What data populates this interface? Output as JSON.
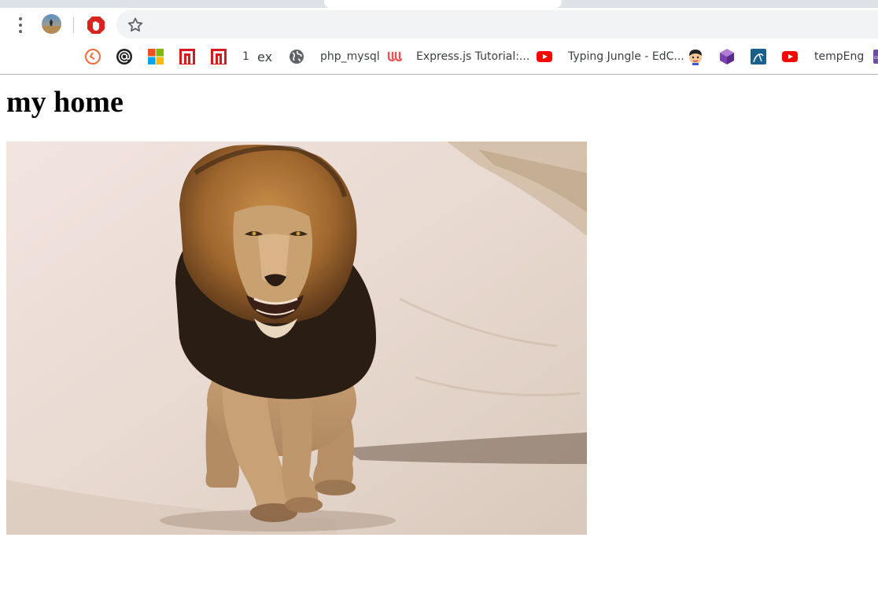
{
  "browser": {
    "bookmarks": [
      {
        "label": "",
        "icon": "clockify-icon"
      },
      {
        "label": "",
        "icon": "at-sign-icon"
      },
      {
        "label": "",
        "icon": "microsoft-icon"
      },
      {
        "label": "",
        "icon": "red-n-icon"
      },
      {
        "label": "",
        "icon": "red-n-icon"
      },
      {
        "label": "1",
        "icon": ""
      },
      {
        "label": "ex",
        "icon": ""
      },
      {
        "label": "php_mysql",
        "icon": "globe-icon"
      },
      {
        "label": "Express.js Tutorial:...",
        "icon": "udemy-icon"
      },
      {
        "label": "",
        "icon": "youtube-icon"
      },
      {
        "label": "Typing Jungle - EdC...",
        "icon": ""
      },
      {
        "label": "",
        "icon": "cartoon-face-icon"
      },
      {
        "label": "",
        "icon": "cube-icon"
      },
      {
        "label": "",
        "icon": "mysql-icon"
      },
      {
        "label": "",
        "icon": "youtube-icon"
      },
      {
        "label": "tempEng",
        "icon": "colorful-icon"
      }
    ]
  },
  "page": {
    "heading": "my home",
    "image_alt": "Lion walking on a sandy path"
  }
}
